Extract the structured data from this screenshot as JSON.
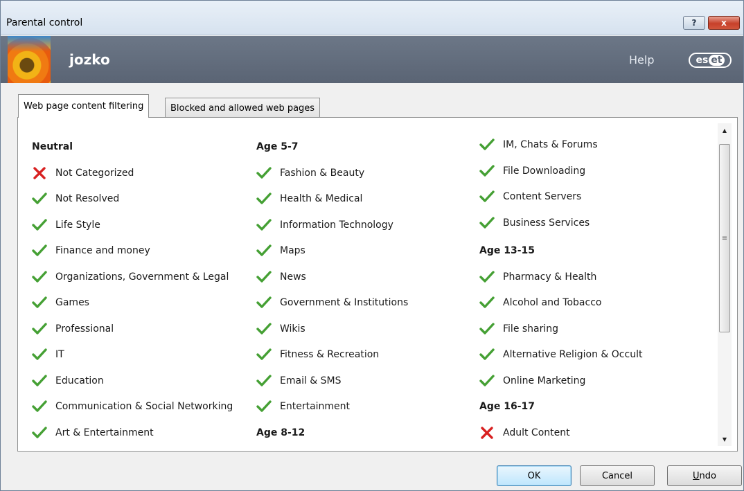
{
  "window": {
    "title": "Parental control"
  },
  "titlebar": {
    "help_glyph": "?",
    "close_glyph": "x"
  },
  "header": {
    "username": "jozko",
    "help_label": "Help",
    "logo_text_1": "es",
    "logo_text_2": "et"
  },
  "tabs": [
    {
      "label": "Web page content filtering",
      "active": true
    },
    {
      "label": "Blocked and allowed web pages",
      "active": false
    }
  ],
  "colors": {
    "allowed": "#45a034",
    "blocked": "#d82020",
    "header_bg": "#606b7b"
  },
  "columns": [
    {
      "heading": "Neutral",
      "items": [
        {
          "label": "Not Categorized",
          "status": "blocked"
        },
        {
          "label": "Not Resolved",
          "status": "allowed"
        },
        {
          "label": "Life Style",
          "status": "allowed"
        },
        {
          "label": "Finance and money",
          "status": "allowed"
        },
        {
          "label": "Organizations, Government & Legal",
          "status": "allowed"
        },
        {
          "label": "Games",
          "status": "allowed"
        },
        {
          "label": "Professional",
          "status": "allowed"
        },
        {
          "label": "IT",
          "status": "allowed"
        },
        {
          "label": "Education",
          "status": "allowed"
        },
        {
          "label": "Communication & Social Networking",
          "status": "allowed"
        },
        {
          "label": "Art & Entertainment",
          "status": "allowed"
        }
      ]
    },
    {
      "heading": "Age 5-7",
      "items": [
        {
          "label": "Fashion & Beauty",
          "status": "allowed"
        },
        {
          "label": "Health & Medical",
          "status": "allowed"
        },
        {
          "label": "Information Technology",
          "status": "allowed"
        },
        {
          "label": "Maps",
          "status": "allowed"
        },
        {
          "label": "News",
          "status": "allowed"
        },
        {
          "label": "Government & Institutions",
          "status": "allowed"
        },
        {
          "label": "Wikis",
          "status": "allowed"
        },
        {
          "label": "Fitness & Recreation",
          "status": "allowed"
        },
        {
          "label": "Email & SMS",
          "status": "allowed"
        },
        {
          "label": "Entertainment",
          "status": "allowed"
        }
      ],
      "heading_after": "Age 8-12"
    },
    {
      "items_top": [
        {
          "label": "IM, Chats & Forums",
          "status": "allowed"
        },
        {
          "label": "File Downloading",
          "status": "allowed"
        },
        {
          "label": "Content Servers",
          "status": "allowed"
        },
        {
          "label": "Business Services",
          "status": "allowed"
        }
      ],
      "heading_mid": "Age 13-15",
      "items_mid": [
        {
          "label": "Pharmacy & Health",
          "status": "allowed"
        },
        {
          "label": "Alcohol and Tobacco",
          "status": "allowed"
        },
        {
          "label": "File sharing",
          "status": "allowed"
        },
        {
          "label": "Alternative Religion & Occult",
          "status": "allowed"
        },
        {
          "label": "Online Marketing",
          "status": "allowed"
        }
      ],
      "heading_last": "Age 16-17",
      "items_last": [
        {
          "label": "Adult Content",
          "status": "blocked"
        }
      ]
    }
  ],
  "scrollbar": {
    "up_glyph": "▲",
    "down_glyph": "▼",
    "grip_glyph": "≡"
  },
  "buttons": {
    "ok": "OK",
    "cancel": "Cancel",
    "undo_first": "U",
    "undo_rest": "ndo"
  }
}
